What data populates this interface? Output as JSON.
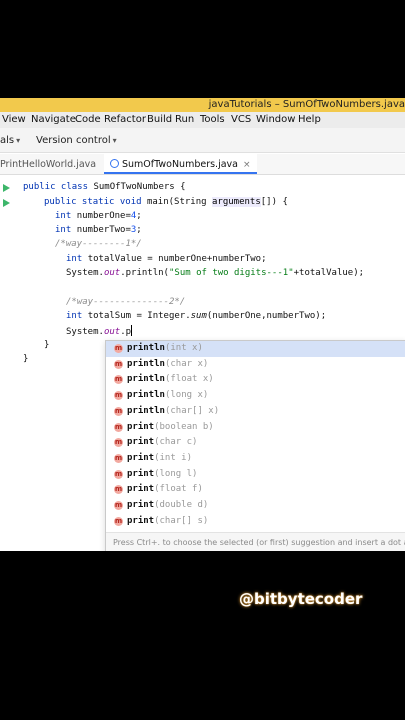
{
  "window": {
    "title": "javaTutorials – SumOfTwoNumbers.java"
  },
  "menu": [
    "View",
    "Navigate",
    "Code",
    "Refactor",
    "Build",
    "Run",
    "Tools",
    "VCS",
    "Window",
    "Help"
  ],
  "toolbar": {
    "project_label": "als",
    "vcs_label": "Version control"
  },
  "tabs": {
    "inactive": {
      "label": "PrintHelloWorld.java"
    },
    "active": {
      "label": "SumOfTwoNumbers.java",
      "close": "×"
    }
  },
  "code": {
    "class_kw": "public class ",
    "class_name": "SumOfTwoNumbers {",
    "main_kw": "public static void ",
    "main_sig": "main(String ",
    "main_param": "arguments",
    "main_end": "[]) {",
    "int1_kw": "int ",
    "int1_rest": "numberOne=",
    "int1_val": "4",
    "int1_end": ";",
    "int2_kw": "int ",
    "int2_rest": "numberTwo=",
    "int2_val": "3",
    "int2_end": ";",
    "comment1": "/*way--------1*/",
    "total_kw": "int ",
    "total_rest": "totalValue = numberOne+numberTwo;",
    "print1_a": "System.",
    "print1_out": "out",
    "print1_b": ".println(",
    "print1_str": "\"Sum of two digits---1\"",
    "print1_c": "+totalValue);",
    "comment2": "/*way--------------2*/",
    "sum_kw": "int ",
    "sum_rest": "totalSum = Integer.",
    "sum_method": "sum",
    "sum_args": "(numberOne,numberTwo);",
    "typing_a": "System.",
    "typing_out": "out",
    "typing_b": ".p",
    "brace_inner": "}",
    "brace_outer": "}"
  },
  "completion": {
    "items": [
      {
        "icon": "method-icon",
        "name": "println",
        "args": "(int x)"
      },
      {
        "icon": "method-icon",
        "name": "println",
        "args": "(char x)"
      },
      {
        "icon": "method-icon",
        "name": "println",
        "args": "(float x)"
      },
      {
        "icon": "method-icon",
        "name": "println",
        "args": "(long x)"
      },
      {
        "icon": "method-icon",
        "name": "println",
        "args": "(char[] x)"
      },
      {
        "icon": "method-icon",
        "name": "print",
        "args": "(boolean b)"
      },
      {
        "icon": "method-icon",
        "name": "print",
        "args": "(char c)"
      },
      {
        "icon": "method-icon",
        "name": "print",
        "args": "(int i)"
      },
      {
        "icon": "method-icon",
        "name": "print",
        "args": "(long l)"
      },
      {
        "icon": "method-icon",
        "name": "print",
        "args": "(float f)"
      },
      {
        "icon": "method-icon",
        "name": "print",
        "args": "(double d)"
      },
      {
        "icon": "method-icon",
        "name": "print",
        "args": "(char[] s)"
      }
    ],
    "hint": "Press Ctrl+. to choose the selected (or first) suggestion and insert a dot afterwards"
  },
  "watermark": "@bitbytecoder",
  "colors": {
    "title_bar": "#f2c94c",
    "keyword": "#0033b3",
    "string": "#067d17",
    "number": "#1750eb",
    "selection": "#d5e1f7"
  }
}
